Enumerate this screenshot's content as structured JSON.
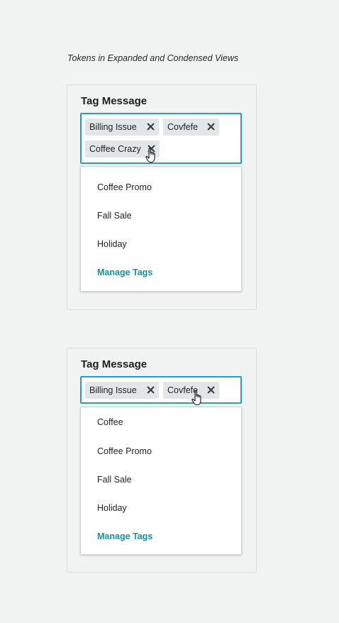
{
  "caption": "Tokens in Expanded and Condensed Views",
  "expanded": {
    "title": "Tag Message",
    "tokens": [
      "Billing Issue",
      "Covfefe",
      "Coffee Crazy"
    ],
    "dropdown": [
      "Coffee Promo",
      "Fall Sale",
      "Holiday"
    ],
    "manage_label": "Manage Tags"
  },
  "condensed": {
    "title": "Tag Message",
    "tokens": [
      "Billing Issue",
      "Covfefe"
    ],
    "dropdown": [
      "Coffee",
      "Coffee Promo",
      "Fall Sale",
      "Holiday"
    ],
    "manage_label": "Manage Tags"
  },
  "icons": {
    "remove": "close-icon",
    "pointer": "hand-pointer-cursor"
  },
  "colors": {
    "focus_border": "#21a3b3",
    "manage_link": "#1392a6",
    "token_bg": "#e3e6e7",
    "page_bg": "#f1f3f2"
  }
}
